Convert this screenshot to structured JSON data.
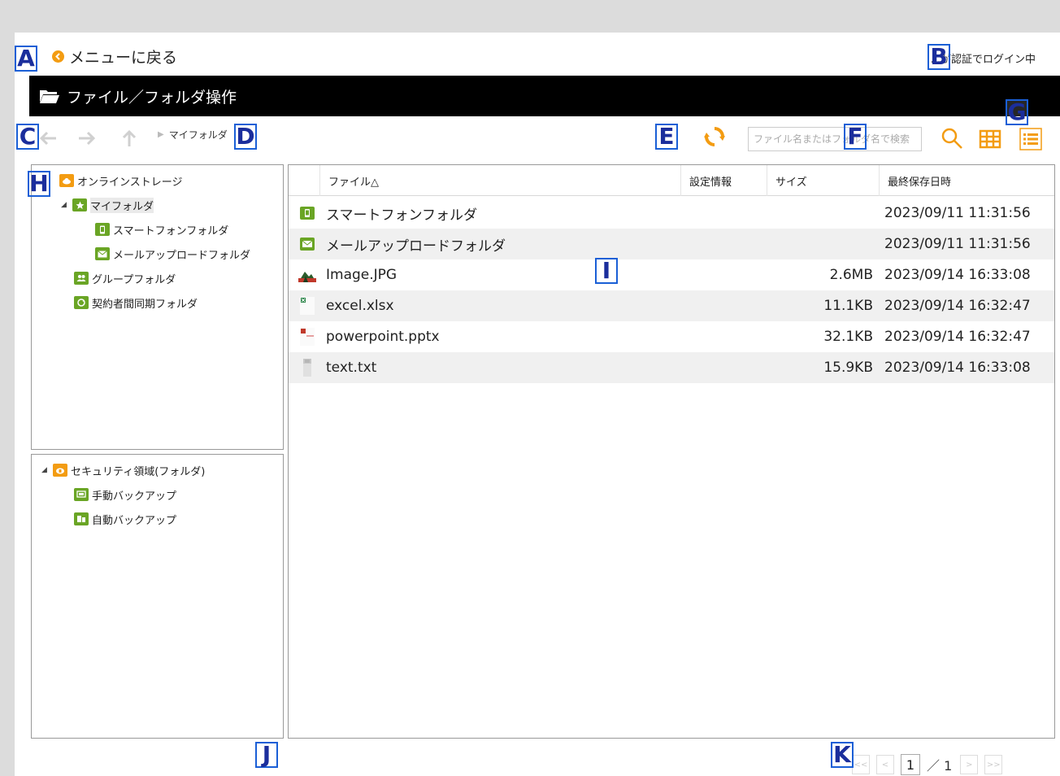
{
  "header": {
    "back_label": "メニューに戻る",
    "login_status": "...が認証でログイン中",
    "title": "ファイル／フォルダ操作"
  },
  "toolbar": {
    "breadcrumb": "マイフォルダ",
    "search_placeholder": "ファイル名またはフォルダ名で検索"
  },
  "tree_top": {
    "items": [
      {
        "label": "オンラインストレージ"
      },
      {
        "label": "マイフォルダ"
      },
      {
        "label": "スマートフォンフォルダ"
      },
      {
        "label": "メールアップロードフォルダ"
      },
      {
        "label": "グループフォルダ"
      },
      {
        "label": "契約者間同期フォルダ"
      }
    ]
  },
  "tree_bottom": {
    "items": [
      {
        "label": "セキュリティ領域(フォルダ)"
      },
      {
        "label": "手動バックアップ"
      },
      {
        "label": "自動バックアップ"
      }
    ]
  },
  "file_list": {
    "columns": [
      "ファイル△",
      "設定情報",
      "サイズ",
      "最終保存日時"
    ],
    "rows": [
      {
        "name": "スマートフォンフォルダ",
        "size": "",
        "date": "2023/09/11 11:31:56",
        "icon": "smartphone-folder-icon"
      },
      {
        "name": "メールアップロードフォルダ",
        "size": "",
        "date": "2023/09/11 11:31:56",
        "icon": "mail-folder-icon"
      },
      {
        "name": "Image.JPG",
        "size": "2.6MB",
        "date": "2023/09/14 16:33:08",
        "icon": "image-file-icon"
      },
      {
        "name": "excel.xlsx",
        "size": "11.1KB",
        "date": "2023/09/14 16:32:47",
        "icon": "excel-file-icon"
      },
      {
        "name": "powerpoint.pptx",
        "size": "32.1KB",
        "date": "2023/09/14 16:32:47",
        "icon": "powerpoint-file-icon"
      },
      {
        "name": "text.txt",
        "size": "15.9KB",
        "date": "2023/09/14 16:33:08",
        "icon": "text-file-icon"
      }
    ]
  },
  "pagination": {
    "first": "<<",
    "prev": "<",
    "current": "1",
    "total": "／ 1",
    "next": ">",
    "last": ">>"
  },
  "markers": [
    "A",
    "B",
    "C",
    "D",
    "E",
    "F",
    "G",
    "H",
    "I",
    "J",
    "K"
  ],
  "colors": {
    "accent_orange": "#f39c12",
    "folder_green": "#6aa525",
    "title_bar": "#000000",
    "marker_blue": "#1a5fd6"
  }
}
